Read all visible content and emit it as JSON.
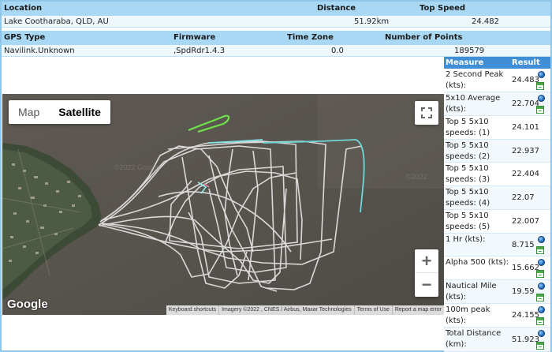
{
  "info": {
    "headers1": {
      "location": "Location",
      "distance": "Distance",
      "top_speed": "Top Speed"
    },
    "values1": {
      "location": "Lake Cootharaba, QLD, AU",
      "distance": "51.92km",
      "top_speed": "24.482"
    },
    "headers2": {
      "gps_type": "GPS Type",
      "firmware": "Firmware",
      "time_zone": "Time Zone",
      "points": "Number of Points"
    },
    "values2": {
      "gps_type": "Navilink.Unknown",
      "firmware": ",SpdRdr1.4.3",
      "time_zone": "0.0",
      "points": "189579"
    }
  },
  "map": {
    "type_map": "Map",
    "type_satellite": "Satellite",
    "google": "Google",
    "attribution": [
      "Keyboard shortcuts",
      "Imagery ©2022 , CNES / Airbus, Maxar Technologies",
      "Terms of Use",
      "Report a map error"
    ]
  },
  "measures": {
    "header_measure": "Measure",
    "header_result": "Result",
    "rows": [
      {
        "name": "2 Second Peak (kts):",
        "value": "24.483",
        "icons": [
          "globe",
          "calendar"
        ]
      },
      {
        "name": "5x10 Average (kts):",
        "value": "22.704",
        "icons": [
          "globe",
          "calendar"
        ]
      },
      {
        "name": "Top 5 5x10 speeds: (1)",
        "value": "24.101",
        "icons": []
      },
      {
        "name": "Top 5 5x10 speeds: (2)",
        "value": "22.937",
        "icons": []
      },
      {
        "name": "Top 5 5x10 speeds: (3)",
        "value": "22.404",
        "icons": []
      },
      {
        "name": "Top 5 5x10 speeds: (4)",
        "value": "22.07",
        "icons": []
      },
      {
        "name": "Top 5 5x10 speeds: (5)",
        "value": "22.007",
        "icons": []
      },
      {
        "name": "1 Hr (kts):",
        "value": "8.715",
        "icons": [
          "globe",
          "calendar"
        ]
      },
      {
        "name": "Alpha 500 (kts):",
        "value": "15.662",
        "icons": [
          "globe",
          "calendar"
        ]
      },
      {
        "name": "Nautical Mile (kts):",
        "value": "19.59",
        "icons": [
          "globe",
          "calendar"
        ]
      },
      {
        "name": "100m peak (kts):",
        "value": "24.155",
        "icons": [
          "globe",
          "calendar"
        ]
      },
      {
        "name": "Total Distance (km):",
        "value": "51.923",
        "icons": [
          "globe",
          "calendar"
        ]
      }
    ]
  },
  "colors": {
    "header_bg": "#a9d8f4",
    "measures_header_bg": "#3f8ed6",
    "track_main": "#e6e6e6",
    "track_fast": "#7ee0e0",
    "track_green": "#66dd44"
  }
}
